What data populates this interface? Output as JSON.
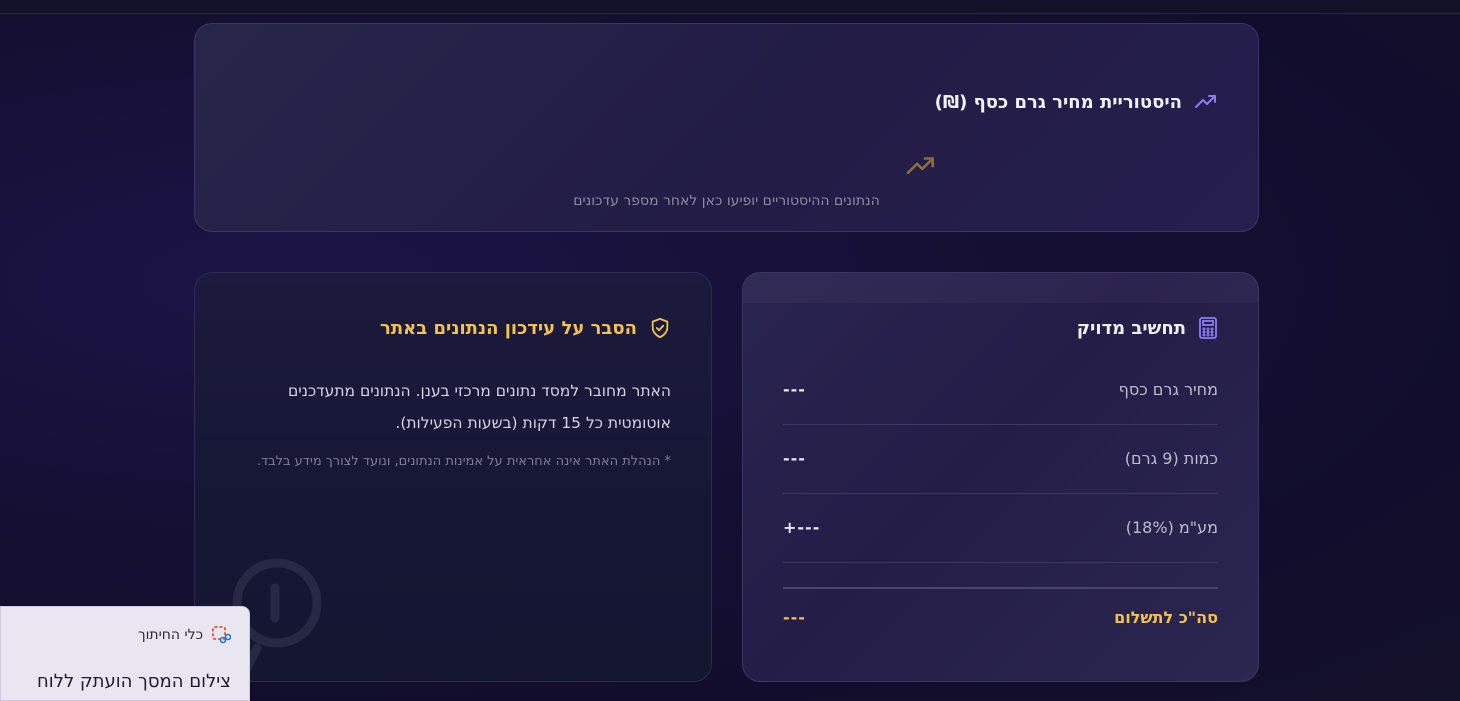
{
  "history": {
    "title": "היסטוריית מחיר גרם כסף (₪)",
    "empty_text": "הנתונים ההיסטוריים יופיעו כאן לאחר מספר עדכונים"
  },
  "info": {
    "title": "הסבר על עידכון הנתונים באתר",
    "body": "האתר מחובר למסד נתונים מרכזי בענן. הנתונים מתעדכנים אוטומטית כל 15 דקות (בשעות הפעילות).",
    "note": "* הנהלת האתר אינה אחראית על אמינות הנתונים, ונועד לצורך מידע בלבד."
  },
  "calculator": {
    "title": "תחשיב מדויק",
    "rows": [
      {
        "label": "מחיר גרם כסף",
        "value": "---"
      },
      {
        "label": "כמות (9 גרם)",
        "value": "---"
      },
      {
        "label": "מע\"מ (18%)",
        "value": "+---"
      }
    ],
    "total_label": "סה\"כ לתשלום",
    "total_value": "---"
  },
  "snip": {
    "app_name": "כלי החיתוך",
    "message": "צילום המסך הועתק ללוח"
  },
  "colors": {
    "accent_gold": "#f2c14e",
    "accent_purple": "#8b7cf6"
  }
}
